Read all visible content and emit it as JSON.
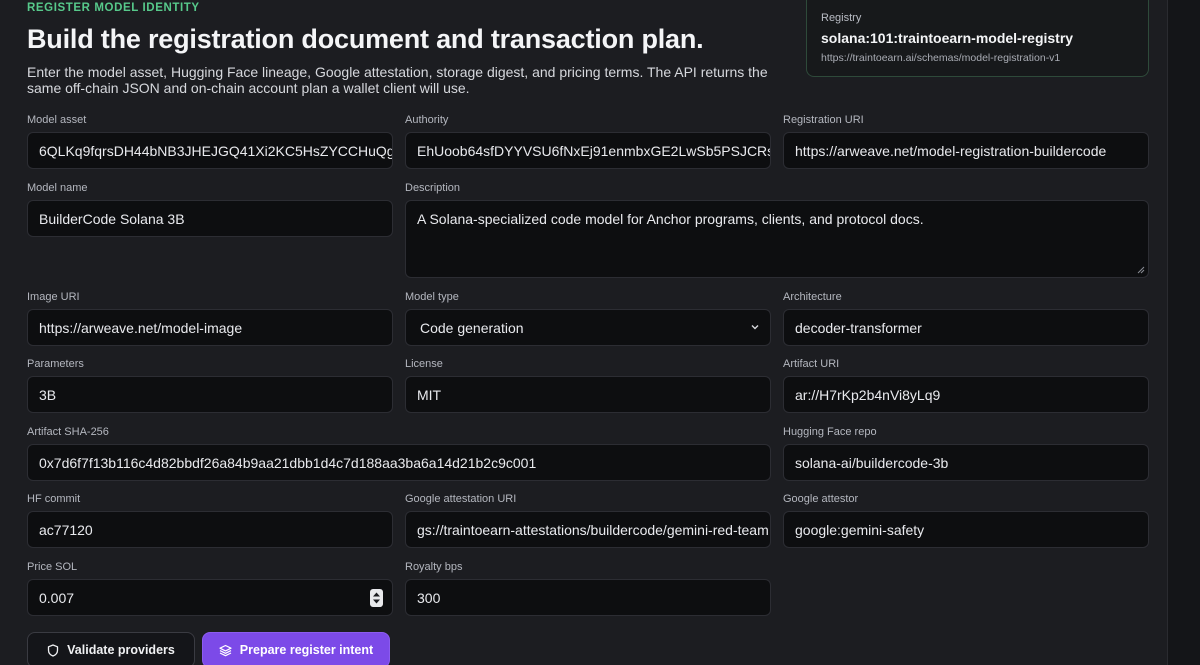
{
  "header": {
    "eyebrow": "REGISTER MODEL IDENTITY",
    "title": "Build the registration document and transaction plan.",
    "lede": "Enter the model asset, Hugging Face lineage, Google attestation, storage digest, and pricing terms. The API returns the same off-chain JSON and on-chain account plan a wallet client will use."
  },
  "registry": {
    "label": "Registry",
    "value": "solana:101:traintoearn-model-registry",
    "url": "https://traintoearn.ai/schemas/model-registration-v1"
  },
  "form": {
    "model_asset": {
      "label": "Model asset",
      "value": "6QLKq9fqrsDH44bNB3JHEJGQ41Xi2KC5HsZYCCHuQg"
    },
    "authority": {
      "label": "Authority",
      "value": "EhUoob64sfDYYVSU6fNxEj91enmbxGE2LwSb5PSJCRs"
    },
    "registration_uri": {
      "label": "Registration URI",
      "value": "https://arweave.net/model-registration-buildercode"
    },
    "model_name": {
      "label": "Model name",
      "value": "BuilderCode Solana 3B"
    },
    "description": {
      "label": "Description",
      "value": "A Solana-specialized code model for Anchor programs, clients, and protocol docs."
    },
    "image_uri": {
      "label": "Image URI",
      "value": "https://arweave.net/model-image"
    },
    "model_type": {
      "label": "Model type",
      "value": "Code generation"
    },
    "architecture": {
      "label": "Architecture",
      "value": "decoder-transformer"
    },
    "parameters": {
      "label": "Parameters",
      "value": "3B"
    },
    "license": {
      "label": "License",
      "value": "MIT"
    },
    "artifact_uri": {
      "label": "Artifact URI",
      "value": "ar://H7rKp2b4nVi8yLq9"
    },
    "artifact_sha": {
      "label": "Artifact SHA-256",
      "value": "0x7d6f7f13b116c4d82bbdf26a84b9aa21dbb1d4c7d188aa3ba6a14d21b2c9c001"
    },
    "hf_repo": {
      "label": "Hugging Face repo",
      "value": "solana-ai/buildercode-3b"
    },
    "hf_commit": {
      "label": "HF commit",
      "value": "ac77120"
    },
    "google_attestation_uri": {
      "label": "Google attestation URI",
      "value": "gs://traintoearn-attestations/buildercode/gemini-red-team"
    },
    "google_attestor": {
      "label": "Google attestor",
      "value": "google:gemini-safety"
    },
    "price_sol": {
      "label": "Price SOL",
      "value": "0.007"
    },
    "royalty_bps": {
      "label": "Royalty bps",
      "value": "300"
    }
  },
  "actions": {
    "validate_label": "Validate providers",
    "validate_icon": "shield-icon",
    "prepare_label": "Prepare register intent",
    "prepare_icon": "layers-icon"
  },
  "colors": {
    "accent": "#7c4ae8",
    "eyebrow": "#57c98b",
    "background": "#1c1d21"
  }
}
